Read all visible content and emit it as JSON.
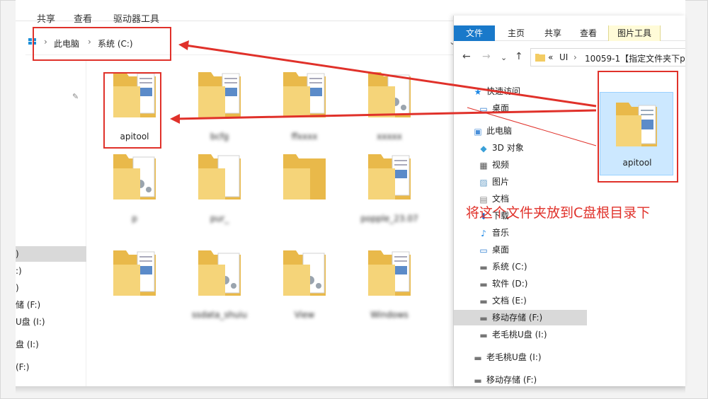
{
  "back_window": {
    "ribbon_tabs": [
      "共享",
      "查看",
      "驱动器工具"
    ],
    "breadcrumb": [
      "此电脑",
      "系统 (C:)"
    ],
    "nav_items": [
      ")",
      ":)",
      ")",
      "储 (F:)",
      "U盘 (I:)",
      "盘 (I:)",
      "(F:)"
    ],
    "selected_nav_index": 0,
    "folders": [
      {
        "label": "apitool",
        "blurred": false,
        "type": "doc"
      },
      {
        "label": "bcfg",
        "blurred": true,
        "type": "doc"
      },
      {
        "label": "ffxxxx",
        "blurred": true,
        "type": "doc"
      },
      {
        "label": "xxxxx",
        "blurred": true,
        "type": "gear"
      },
      {
        "label": "J",
        "blurred": true,
        "type": "doc"
      },
      {
        "label": "p",
        "blurred": true,
        "type": "gear"
      },
      {
        "label": "pur_",
        "blurred": true,
        "type": "blank"
      },
      {
        "label": "",
        "blurred": true,
        "type": "plain"
      },
      {
        "label": "popple_23.07",
        "blurred": true,
        "type": "doc"
      },
      {
        "label": "Pr",
        "blurred": true,
        "type": "doc"
      },
      {
        "label": "",
        "blurred": true,
        "type": "doc"
      },
      {
        "label": "ssdata_shuiu",
        "blurred": true,
        "type": "gear"
      },
      {
        "label": "View",
        "blurred": true,
        "type": "gear"
      },
      {
        "label": "Windows",
        "blurred": true,
        "type": "doc"
      }
    ]
  },
  "front_window": {
    "ribbon_tabs": {
      "file": "文件",
      "home": "主页",
      "share": "共享",
      "view": "查看",
      "picture_tools": "图片工具"
    },
    "address": {
      "prefix": "«",
      "seg1": "UI",
      "seg2": "10059-1【指定文件夹下p"
    },
    "nav": [
      {
        "label": "快速访问",
        "icon": "star-icon",
        "indent": 0,
        "selected": false
      },
      {
        "label": "桌面",
        "icon": "desktop-icon",
        "indent": 1,
        "selected": false
      },
      {
        "label": "此电脑",
        "icon": "computer-icon",
        "indent": 0,
        "selected": false
      },
      {
        "label": "3D 对象",
        "icon": "cube-icon",
        "indent": 1,
        "selected": false
      },
      {
        "label": "视频",
        "icon": "film-icon",
        "indent": 1,
        "selected": false
      },
      {
        "label": "图片",
        "icon": "picture-icon",
        "indent": 1,
        "selected": false
      },
      {
        "label": "文档",
        "icon": "document-icon",
        "indent": 1,
        "selected": false
      },
      {
        "label": "下载",
        "icon": "download-icon",
        "indent": 1,
        "selected": false
      },
      {
        "label": "音乐",
        "icon": "music-icon",
        "indent": 1,
        "selected": false
      },
      {
        "label": "桌面",
        "icon": "desktop-icon",
        "indent": 1,
        "selected": false
      },
      {
        "label": "系统 (C:)",
        "icon": "drive-icon",
        "indent": 1,
        "selected": false
      },
      {
        "label": "软件 (D:)",
        "icon": "drive-icon",
        "indent": 1,
        "selected": false
      },
      {
        "label": "文档 (E:)",
        "icon": "drive-icon",
        "indent": 1,
        "selected": false
      },
      {
        "label": "移动存储 (F:)",
        "icon": "drive-icon",
        "indent": 1,
        "selected": true
      },
      {
        "label": "老毛桃U盘 (I:)",
        "icon": "drive-icon",
        "indent": 1,
        "selected": false
      },
      {
        "label": "老毛桃U盘 (I:)",
        "icon": "drive-icon",
        "indent": 0,
        "selected": false
      },
      {
        "label": "移动存储 (F:)",
        "icon": "drive-icon",
        "indent": 0,
        "selected": false
      }
    ],
    "folder": {
      "label": "apitool"
    }
  },
  "annotation": {
    "text": "将这个文件夹放到C盘根目录下",
    "color": "#e0312a"
  }
}
